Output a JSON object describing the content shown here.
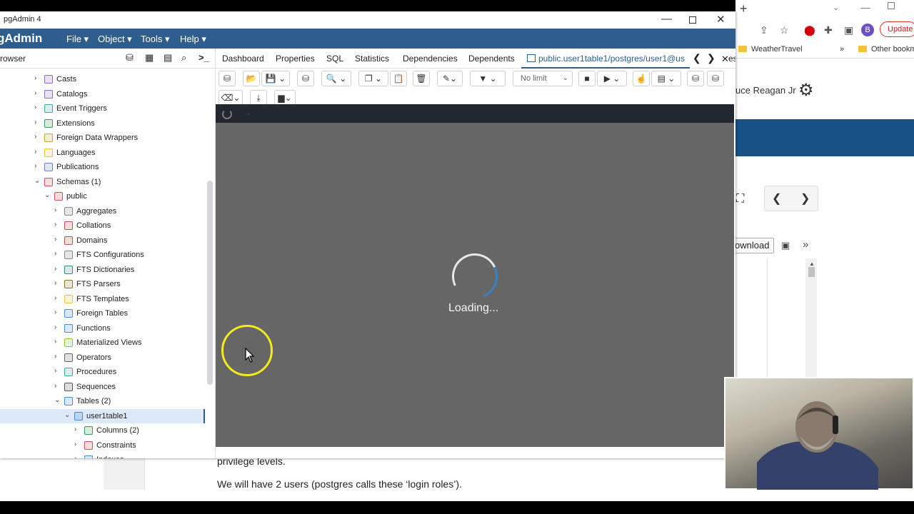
{
  "window": {
    "title": "pgAdmin 4",
    "controls": {
      "minimize": "—",
      "maximize": "",
      "close": "✕"
    }
  },
  "menubar": {
    "logo": "gAdmin",
    "items": [
      "File ▾",
      "Object ▾",
      "Tools ▾",
      "Help ▾"
    ]
  },
  "browser_panel": {
    "title": "rowser",
    "tree": [
      {
        "label": "Casts",
        "icon": "casts-icon",
        "color": "#8b6fc6",
        "depth": 1,
        "expanded": false
      },
      {
        "label": "Catalogs",
        "icon": "catalog-icon",
        "color": "#8b6fc6",
        "depth": 1,
        "expanded": false
      },
      {
        "label": "Event Triggers",
        "icon": "event-trigger-icon",
        "color": "#3aa7a0",
        "depth": 1,
        "expanded": false
      },
      {
        "label": "Extensions",
        "icon": "extension-icon",
        "color": "#3a9a5b",
        "depth": 1,
        "expanded": false
      },
      {
        "label": "Foreign Data Wrappers",
        "icon": "fdw-icon",
        "color": "#c9a23a",
        "depth": 1,
        "expanded": false
      },
      {
        "label": "Languages",
        "icon": "language-icon",
        "color": "#e6c53a",
        "depth": 1,
        "expanded": false
      },
      {
        "label": "Publications",
        "icon": "publication-icon",
        "color": "#6a7fd6",
        "depth": 1,
        "expanded": false
      },
      {
        "label": "Schemas (1)",
        "icon": "schema-icon",
        "color": "#d0505a",
        "depth": 1,
        "expanded": true
      },
      {
        "label": "public",
        "icon": "schema-public-icon",
        "color": "#d0505a",
        "depth": 2,
        "expanded": true
      },
      {
        "label": "Aggregates",
        "icon": "aggregate-icon",
        "color": "#888888",
        "depth": 3,
        "expanded": false
      },
      {
        "label": "Collations",
        "icon": "collation-icon",
        "color": "#d0505a",
        "depth": 3,
        "expanded": false
      },
      {
        "label": "Domains",
        "icon": "domain-icon",
        "color": "#b0554a",
        "depth": 3,
        "expanded": false
      },
      {
        "label": "FTS Configurations",
        "icon": "fts-config-icon",
        "color": "#888888",
        "depth": 3,
        "expanded": false
      },
      {
        "label": "FTS Dictionaries",
        "icon": "fts-dictionary-icon",
        "color": "#3a8a8a",
        "depth": 3,
        "expanded": false
      },
      {
        "label": "FTS Parsers",
        "icon": "fts-parser-icon",
        "color": "#8a7a20",
        "depth": 3,
        "expanded": false
      },
      {
        "label": "FTS Templates",
        "icon": "fts-template-icon",
        "color": "#e6c53a",
        "depth": 3,
        "expanded": false
      },
      {
        "label": "Foreign Tables",
        "icon": "foreign-table-icon",
        "color": "#4a8ad6",
        "depth": 3,
        "expanded": false
      },
      {
        "label": "Functions",
        "icon": "function-icon",
        "color": "#4a8ad6",
        "depth": 3,
        "expanded": false
      },
      {
        "label": "Materialized Views",
        "icon": "materialized-view-icon",
        "color": "#8ac63a",
        "depth": 3,
        "expanded": false
      },
      {
        "label": "Operators",
        "icon": "operator-icon",
        "color": "#666666",
        "depth": 3,
        "expanded": false
      },
      {
        "label": "Procedures",
        "icon": "procedure-icon",
        "color": "#3aa7a0",
        "depth": 3,
        "expanded": false
      },
      {
        "label": "Sequences",
        "icon": "sequence-icon",
        "color": "#555555",
        "depth": 3,
        "expanded": false
      },
      {
        "label": "Tables (2)",
        "icon": "tables-icon",
        "color": "#4a8ad6",
        "depth": 3,
        "expanded": true
      },
      {
        "label": "user1table1",
        "icon": "table-icon",
        "color": "#4a8ad6",
        "depth": 4,
        "expanded": true,
        "selected": true
      },
      {
        "label": "Columns (2)",
        "icon": "columns-icon",
        "color": "#3a9a5b",
        "depth": 5,
        "expanded": false
      },
      {
        "label": "Constraints",
        "icon": "constraint-icon",
        "color": "#d0505a",
        "depth": 5,
        "expanded": false
      },
      {
        "label": "Indexes",
        "icon": "index-icon",
        "color": "#4a8ad6",
        "depth": 5,
        "expanded": false
      }
    ]
  },
  "tabs": {
    "items": [
      "Dashboard",
      "Properties",
      "SQL",
      "Statistics",
      "Dependencies",
      "Dependents"
    ],
    "active": "public.user1table1/postgres/user1@us",
    "partial_next": "es"
  },
  "query_toolbar": {
    "limit_label": "No limit"
  },
  "loading": {
    "text": "Loading..."
  },
  "browser_bg": {
    "bookmark_weather": "WeatherTravel",
    "bookmark_other": "Other bookm",
    "bookmark_more": "»",
    "user_name": "uce Reagan Jr",
    "profile_initial": "B",
    "update_label": "Update",
    "download_label": "ownload"
  },
  "document": {
    "line1": "privilege levels.",
    "line2": "We will have 2 users (postgres calls these ‘login roles’)."
  },
  "colors": {
    "pgadmin_blue": "#2f5e8c",
    "overlay_gray": "#666666",
    "cursor_highlight": "#f2ea1e",
    "chrome_banner": "#175186"
  }
}
